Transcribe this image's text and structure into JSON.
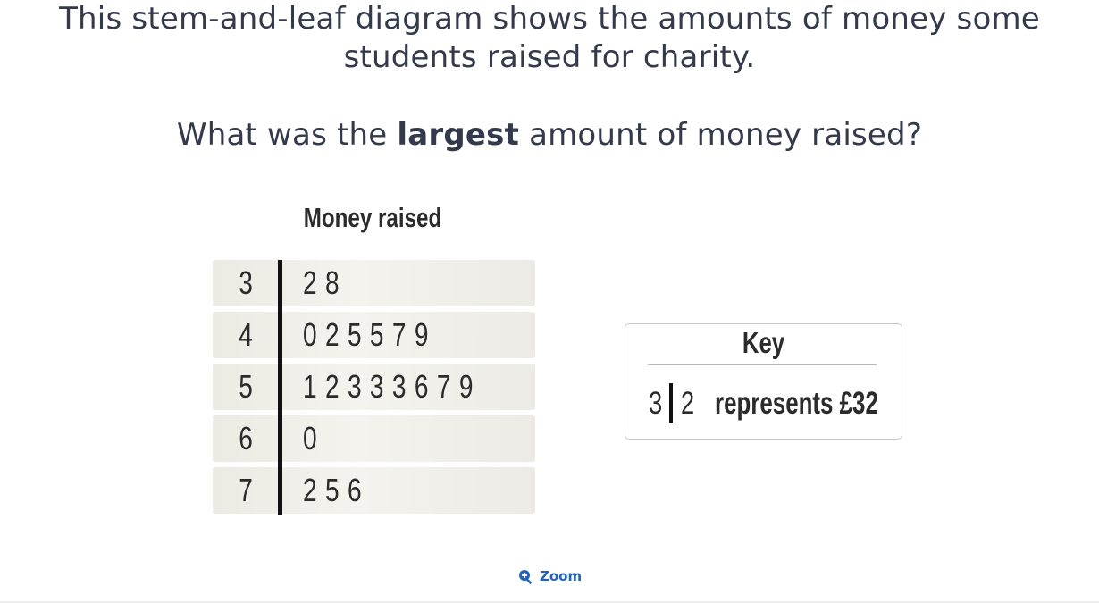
{
  "question": {
    "line1": "This stem-and-leaf diagram shows the amounts of money some",
    "line2": "students raised for charity.",
    "prompt_before": "What was the ",
    "prompt_bold": "largest",
    "prompt_after": " amount of money raised?"
  },
  "diagram": {
    "title": "Money raised",
    "rows": [
      {
        "stem": "3",
        "leaves": "2 8"
      },
      {
        "stem": "4",
        "leaves": "0 2 5 5 7 9"
      },
      {
        "stem": "5",
        "leaves": "1 2 3 3 3 6 7 9"
      },
      {
        "stem": "6",
        "leaves": "0"
      },
      {
        "stem": "7",
        "leaves": "2 5 6"
      }
    ]
  },
  "key": {
    "title": "Key",
    "stem": "3",
    "leaf": "2",
    "text": "represents £32"
  },
  "zoom": {
    "label": "Zoom",
    "icon": "zoom-in-icon",
    "color": "#1d63c8"
  }
}
